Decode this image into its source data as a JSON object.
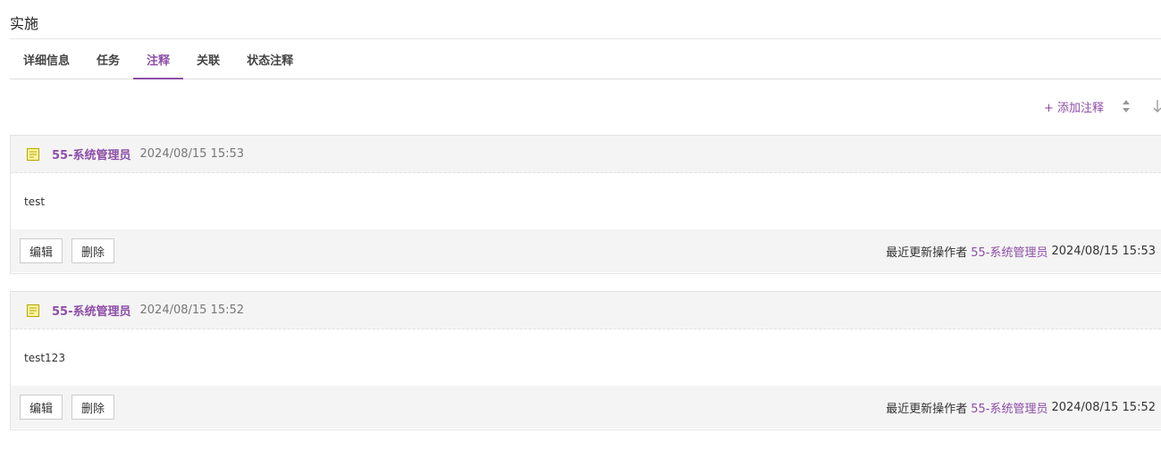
{
  "page": {
    "title": "实施"
  },
  "tabs": [
    {
      "label": "详细信息"
    },
    {
      "label": "任务"
    },
    {
      "label": "注释",
      "active": true
    },
    {
      "label": "关联"
    },
    {
      "label": "状态注释"
    }
  ],
  "toolbar": {
    "add_note_label": "+ 添加注释",
    "sort_icon": "sort-updown-icon",
    "order_icon": "arrow-down-icon"
  },
  "notes": [
    {
      "icon": "note-icon",
      "author": "55-系统管理员",
      "time": "2024/08/15 15:53",
      "content": "test",
      "edit_label": "编辑",
      "delete_label": "删除",
      "updated_label": "最近更新操作者",
      "updated_by": "55-系统管理员",
      "updated_time": "2024/08/15 15:53"
    },
    {
      "icon": "note-icon",
      "author": "55-系统管理员",
      "time": "2024/08/15 15:52",
      "content": "test123",
      "edit_label": "编辑",
      "delete_label": "删除",
      "updated_label": "最近更新操作者",
      "updated_by": "55-系统管理员",
      "updated_time": "2024/08/15 15:52"
    }
  ],
  "colors": {
    "accent": "#8e4ea8",
    "panel_bg": "#f4f4f4",
    "note_icon": "#c9b400"
  }
}
